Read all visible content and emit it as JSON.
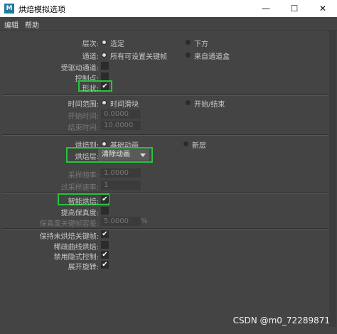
{
  "window": {
    "icon_label": "M",
    "title": "烘焙模拟选项",
    "minimize": "—",
    "maximize": "☐",
    "close": "✕"
  },
  "menu": [
    "编辑",
    "帮助"
  ],
  "layer": {
    "label": "层次:",
    "opt1": "选定",
    "opt2": "下方"
  },
  "channels": {
    "label": "通道:",
    "opt1": "所有可设置关键帧",
    "opt2": "来自通道盒"
  },
  "driven_label": "受驱动通道:",
  "controlpoints_label": "控制点:",
  "shape_label": "形状:",
  "time_range": {
    "label": "时间范围:",
    "opt1": "时间滑块",
    "opt2": "开始/结束"
  },
  "start_time": {
    "label": "开始时间:",
    "value": "0.0000"
  },
  "end_time": {
    "label": "结束时间:",
    "value": "10.0000"
  },
  "bake_to": {
    "label": "烘焙到:",
    "opt1": "基础动画",
    "opt2": "新层"
  },
  "bake_layer": {
    "label": "烘焙层:",
    "value": "清除动画"
  },
  "sample_by": {
    "label": "采样频率:",
    "value": "1.0000"
  },
  "oversample": {
    "label": "过采样速率:",
    "value": "1"
  },
  "smart_bake_label": "智能烘焙:",
  "fidelity_label": "提高保真度:",
  "fidelity_keys": {
    "label": "保真度关键帧容差:",
    "value": "5.0000",
    "unit": "%"
  },
  "options": {
    "keep_unbaked": "保持未烘焙关键帧:",
    "sparse_curve": "稀疏曲线烘焙:",
    "disable_implicit": "禁用隐式控制:",
    "unroll_rotation": "展开旋转:"
  },
  "checkmark": "✔",
  "watermark": "CSDN @m0_72289871",
  "colors": {
    "highlight": "#27c43a",
    "panel_bg": "#444444"
  }
}
